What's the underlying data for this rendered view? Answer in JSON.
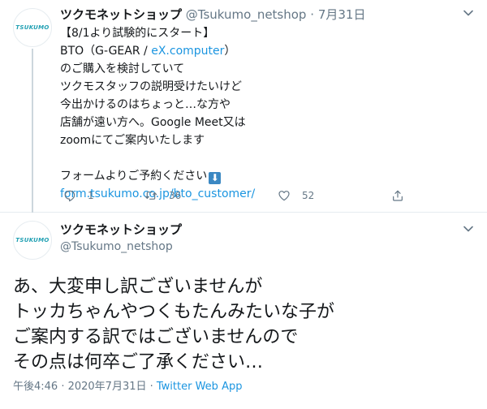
{
  "tweet1": {
    "avatar_logo": "TSUKUMO",
    "name": "ツクモネットショップ",
    "handle": "@Tsukumo_netshop",
    "dot": "·",
    "date": "7月31日",
    "lines": {
      "l1": "【8/1より試験的にスタート】",
      "l2_pre": "BTO（G-GEAR / ",
      "l2_link": "eX.computer",
      "l2_post": "）",
      "l3": "のご購入を検討していて",
      "l4": "ツクモスタッフの説明受けたいけど",
      "l5": "今出かけるのはちょっと…な方や",
      "l6": "店舗が遠い方へ。Google Meet又は",
      "l7": "zoomにてご案内いたします",
      "l8": "フォームよりご予約ください",
      "l8_emoji": "⬇",
      "l9_link": "form.tsukumo.co.jp/bto_customer/"
    },
    "actions": {
      "reply_count": "1",
      "retweet_count": "36",
      "like_count": "52"
    }
  },
  "tweet2": {
    "avatar_logo": "TSUKUMO",
    "name": "ツクモネットショップ",
    "handle": "@Tsukumo_netshop",
    "lines": [
      "あ、大変申し訳ございませんが",
      "トッカちゃんやつくもたんみたいな子が",
      "ご案内する訳ではございませんので",
      "その点は何卒ご了承ください…"
    ],
    "timestamp": "午後4:46 · 2020年7月31日 · ",
    "source": "Twitter Web App"
  },
  "colors": {
    "link": "#1b95e0",
    "secondary_text": "#657786",
    "border": "#e6ecf0",
    "logo": "#21a0b3"
  }
}
